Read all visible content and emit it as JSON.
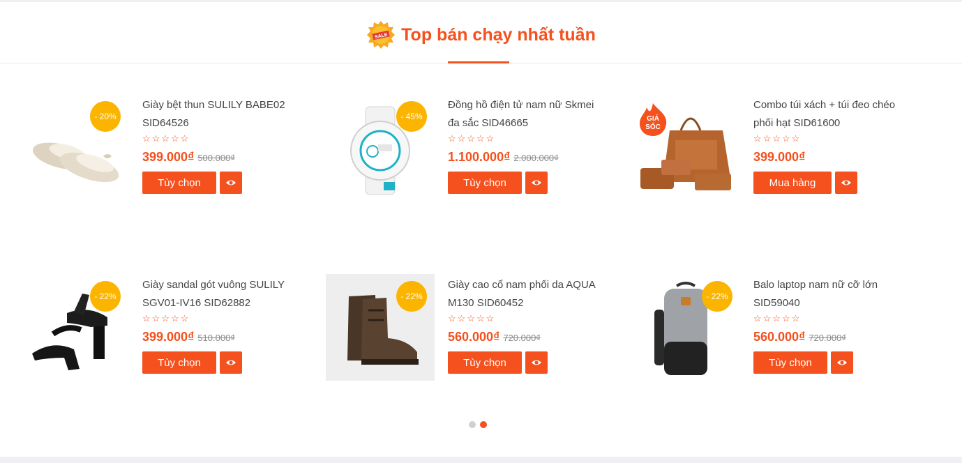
{
  "section": {
    "title": "Top bán chạy nhất tuần",
    "badge_text": "SALE"
  },
  "products": [
    {
      "name": "Giày bệt thun SULILY BABE02 SID64526",
      "stars": "☆☆☆☆☆",
      "price": "399.000₫",
      "old_price": "500.000₫",
      "discount": "- 20%",
      "button": "Tùy chọn"
    },
    {
      "name": "Đồng hồ điện tử nam nữ Skmei đa sắc SID46665",
      "stars": "☆☆☆☆☆",
      "price": "1.100.000₫",
      "old_price": "2.000.000₫",
      "discount": "- 45%",
      "button": "Tùy chọn"
    },
    {
      "name": "Combo túi xách + túi đeo chéo phối hạt SID61600",
      "stars": "☆☆☆☆☆",
      "price": "399.000₫",
      "old_price": "",
      "hot_label_1": "GIÁ",
      "hot_label_2": "SỐC",
      "button": "Mua hàng"
    },
    {
      "name": "Giày sandal gót vuông SULILY SGV01-IV16 SID62882",
      "stars": "☆☆☆☆☆",
      "price": "399.000₫",
      "old_price": "510.000₫",
      "discount": "- 22%",
      "button": "Tùy chọn"
    },
    {
      "name": "Giày cao cổ nam phối da AQUA M130 SID60452",
      "stars": "☆☆☆☆☆",
      "price": "560.000₫",
      "old_price": "720.000₫",
      "discount": "- 22%",
      "button": "Tùy chọn"
    },
    {
      "name": "Balo laptop nam nữ cỡ lớn SID59040",
      "stars": "☆☆☆☆☆",
      "price": "560.000₫",
      "old_price": "720.000₫",
      "discount": "- 22%",
      "button": "Tùy chọn"
    }
  ],
  "pagination": {
    "pages": 2,
    "active": 2
  },
  "colors": {
    "accent": "#f4511e",
    "badge": "#fbb400"
  }
}
